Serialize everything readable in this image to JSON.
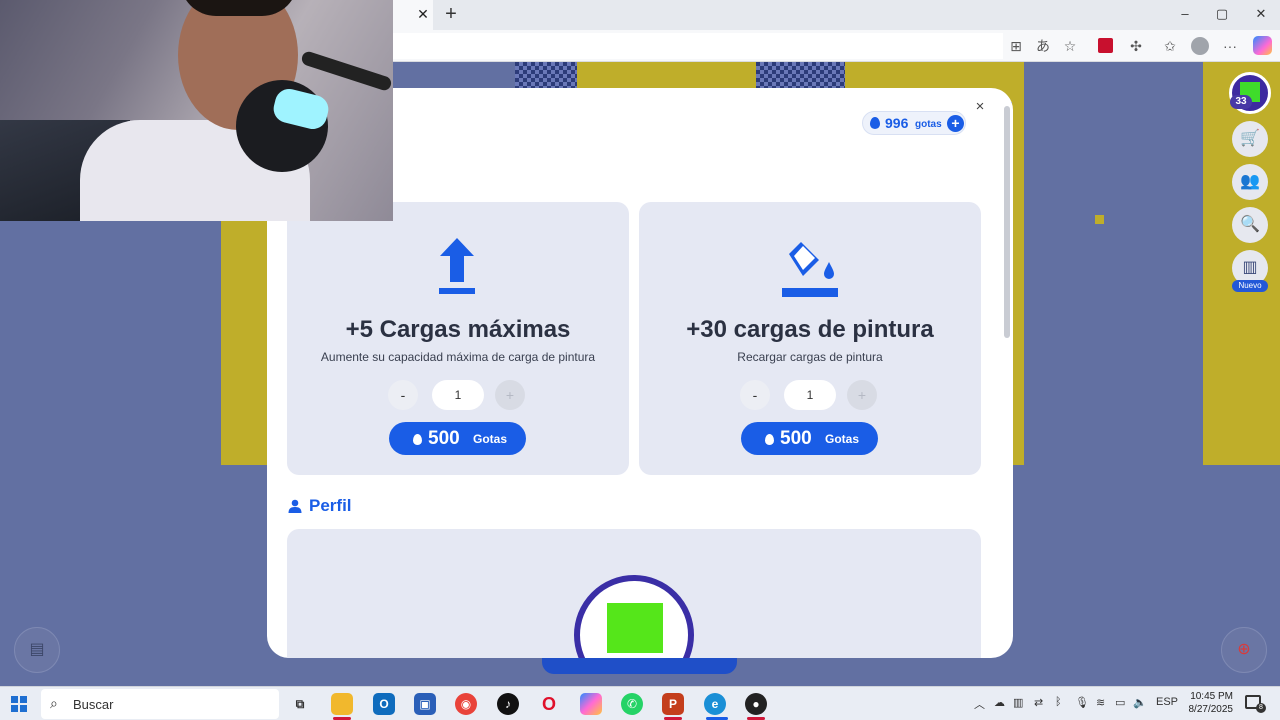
{
  "colors": {
    "accent": "#1a5de6",
    "canvas_bg": "#6270a2",
    "canvas_yellow": "#bfae2a",
    "card_bg": "#e5e8f3"
  },
  "browser": {
    "tab_close": "✕",
    "new_tab": "+",
    "window_controls": [
      "–",
      "▢",
      "✕"
    ],
    "toolbar_icons": [
      "app-icon",
      "translate-icon",
      "star-icon",
      "extension-icon",
      "puzzle-icon",
      "favorites-icon",
      "profile-icon",
      "more-icon",
      "copilot-icon"
    ],
    "more_label": "···"
  },
  "game": {
    "level": "33",
    "new_badge": "Nuevo",
    "side_buttons": [
      "cart-icon",
      "people-icon",
      "search-icon",
      "leaderboard-icon"
    ]
  },
  "modal": {
    "balance": {
      "amount": "996",
      "unit": "gotas",
      "add": "+"
    },
    "close": "×",
    "cards": [
      {
        "title": "+5 Cargas máximas",
        "description": "Aumente su capacidad máxima de carga de pintura",
        "icon": "upload-arrow-icon",
        "minus": "-",
        "quantity": "1",
        "plus": "+",
        "price": "500",
        "price_unit": "Gotas"
      },
      {
        "title": "+30 cargas de pintura",
        "description": "Recargar cargas de pintura",
        "icon": "paint-bucket-icon",
        "minus": "-",
        "quantity": "1",
        "plus": "+",
        "price": "500",
        "price_unit": "Gotas"
      }
    ],
    "profile_section": {
      "label": "Perfil",
      "icon": "user-icon"
    }
  },
  "taskbar": {
    "search_placeholder": "Buscar",
    "apps": [
      "task-view",
      "file-explorer",
      "outlook",
      "store",
      "chrome",
      "tiktok",
      "opera",
      "copilot",
      "whatsapp",
      "powerpoint",
      "edge",
      "obs"
    ],
    "language": "ESP",
    "time": "10:45 PM",
    "date": "8/27/2025",
    "notifications": "8"
  }
}
